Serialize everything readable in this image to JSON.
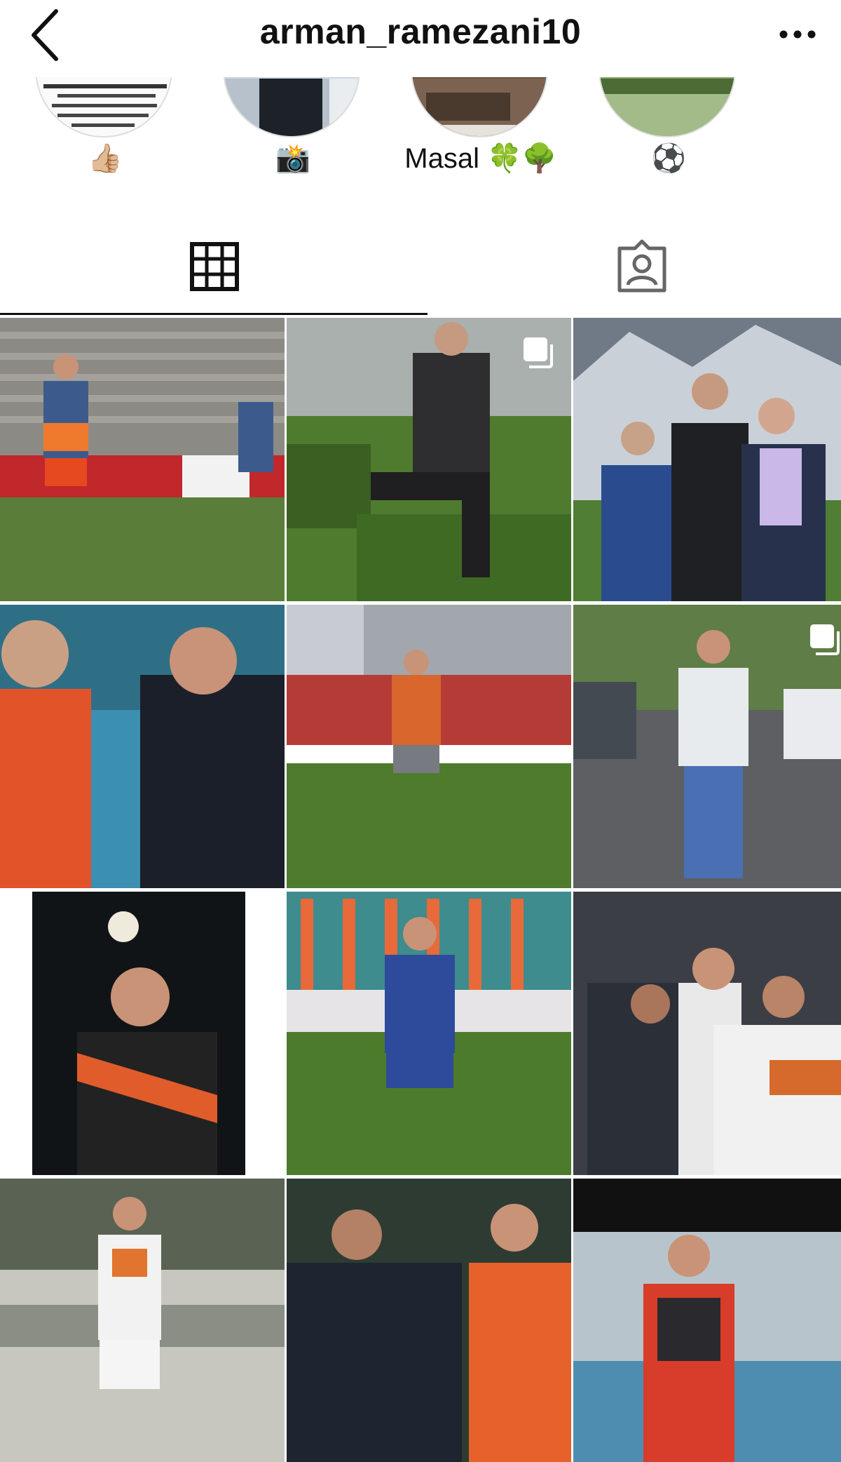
{
  "header": {
    "username": "arman_ramezani10",
    "back_icon": "chevron-left-icon",
    "more_icon": "more-horizontal-icon"
  },
  "highlights": [
    {
      "label": "👍🏼",
      "cover": "instagram-fact-story"
    },
    {
      "label": "📸",
      "cover": "portrait"
    },
    {
      "label": "Masal 🍀🌳",
      "cover": "indoor"
    },
    {
      "label": "⚽",
      "cover": "pitch"
    }
  ],
  "tabs": [
    {
      "name": "posts",
      "icon": "grid-icon",
      "active": true
    },
    {
      "name": "tagged",
      "icon": "tagged-person-icon",
      "active": false
    }
  ],
  "posts": [
    {
      "subject": "goal celebration",
      "multi": false
    },
    {
      "subject": "sitting on hedge",
      "multi": true
    },
    {
      "subject": "family mountains",
      "multi": false
    },
    {
      "subject": "high five with coach",
      "multi": false
    },
    {
      "subject": "walking on pitch",
      "multi": false
    },
    {
      "subject": "street portrait",
      "multi": true
    },
    {
      "subject": "night celebration",
      "multi": false
    },
    {
      "subject": "blue kit on pitch",
      "multi": false
    },
    {
      "subject": "team hug",
      "multi": false
    },
    {
      "subject": "white kit",
      "multi": false
    },
    {
      "subject": "handshake with coach",
      "multi": false
    },
    {
      "subject": "shouting celebration",
      "multi": false
    }
  ]
}
